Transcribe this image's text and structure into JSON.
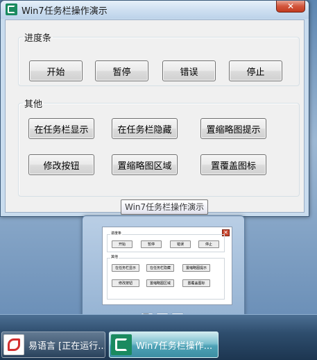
{
  "window": {
    "title": "Win7任务栏操作演示",
    "close_glyph": "✕"
  },
  "progress_group": {
    "legend": "进度条",
    "buttons": [
      "开始",
      "暂停",
      "错误",
      "停止"
    ]
  },
  "other_group": {
    "legend": "其他",
    "buttons": [
      "在任务栏显示",
      "在任务栏隐藏",
      "置缩略图提示",
      "修改按钮",
      "置缩略图区域",
      "置覆盖图标"
    ]
  },
  "tooltip": {
    "text": "Win7任务栏操作演示"
  },
  "preview": {
    "close_glyph": "✕",
    "toolbar_icons": [
      "new-file-icon",
      "open-folder-icon",
      "save-icon"
    ]
  },
  "taskbar": {
    "items": [
      {
        "label": "易语言 [正在运行...",
        "icon": "eyuyan-app-icon",
        "active": false
      },
      {
        "label": "Win7任务栏操作...",
        "icon": "demo-app-icon",
        "active": true
      }
    ]
  },
  "colors": {
    "close_button": "#c23c21",
    "active_task": "#4ea2b6",
    "app_icon": "#1a8a5f"
  }
}
